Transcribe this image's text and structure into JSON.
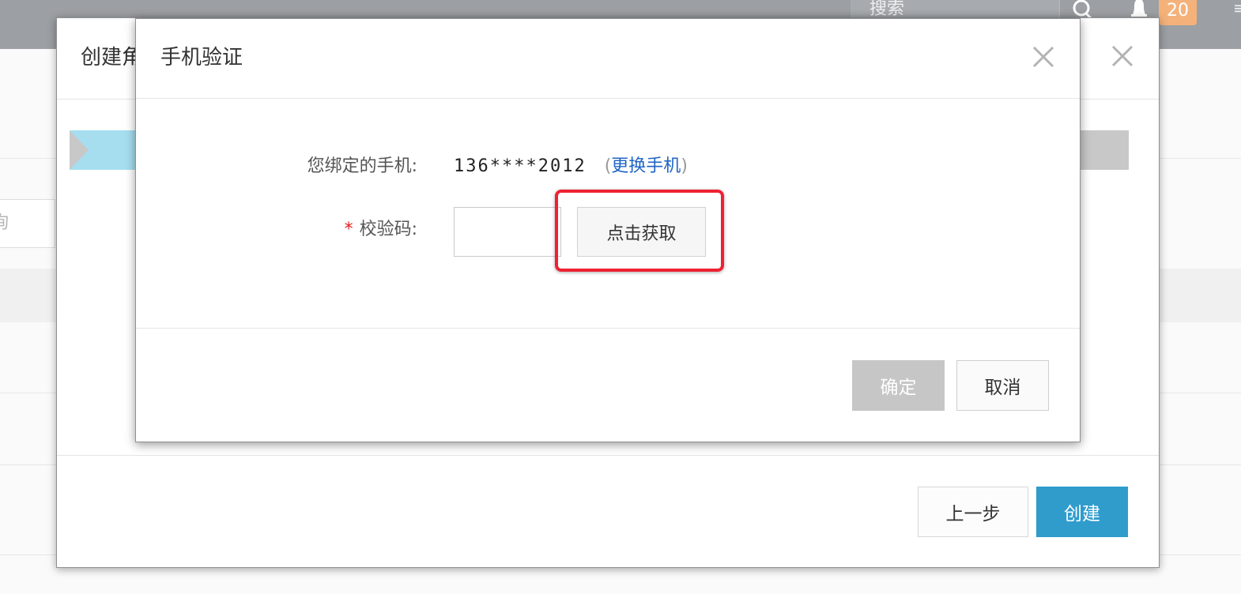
{
  "topbar": {
    "search_placeholder": "搜索",
    "notification_count": "20",
    "more_glyph": "≡"
  },
  "background": {
    "query_placeholder": "询"
  },
  "outer_modal": {
    "title": "创建角",
    "prev_label": "上一步",
    "create_label": "创建"
  },
  "phone_dialog": {
    "title": "手机验证",
    "phone_label": "您绑定的手机:",
    "phone_number": "136****2012",
    "paren_open": "(",
    "change_phone_link": "更换手机",
    "paren_close": ")",
    "required_mark": "*",
    "code_label": "校验码:",
    "code_value": "",
    "get_code_label": "点击获取",
    "confirm_label": "确定",
    "cancel_label": "取消"
  },
  "colors": {
    "topbar": "#9c9fa3",
    "primary": "#2f9ccc",
    "link": "#1f64c4",
    "highlight": "#ee2233",
    "badge": "#f4b27a",
    "disabled": "#c6c6c6"
  }
}
